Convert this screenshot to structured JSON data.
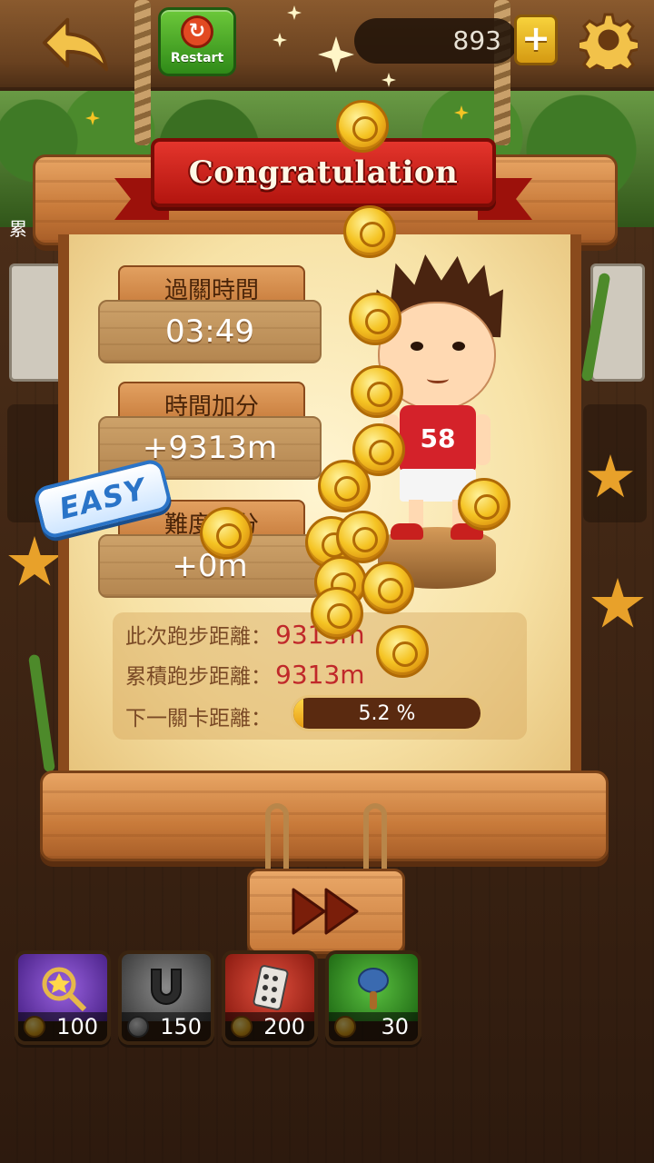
{
  "topbar": {
    "restart_label": "Restart",
    "coin_count": "893",
    "add_coin_label": "+"
  },
  "background": {
    "side_label": "累"
  },
  "result": {
    "title": "Congratulation",
    "difficulty_badge": "EASY",
    "stats": [
      {
        "label": "過關時間",
        "value": "03:49"
      },
      {
        "label": "時間加分",
        "value": "+9313m"
      },
      {
        "label": "難度加分",
        "value": "+0m"
      }
    ],
    "character_number": "58",
    "distance": {
      "this_run_label": "此次跑步距離：",
      "this_run_value": "9313m",
      "total_label": "累積跑步距離：",
      "total_value": "9313m",
      "next_level_label": "下一關卡距離：",
      "next_level_progress_text": "5.2 %",
      "next_level_progress": 5.2
    }
  },
  "powerups": [
    {
      "name": "star-wand",
      "cost": "100",
      "color": "#6a3ab0"
    },
    {
      "name": "magnet",
      "cost": "150",
      "color": "#5a5a5a"
    },
    {
      "name": "dice-card",
      "cost": "200",
      "color": "#b02a22"
    },
    {
      "name": "racket",
      "cost": "30",
      "color": "#2f8a24"
    }
  ],
  "colors": {
    "banner_red": "#d4222a",
    "progress_fill": "#f5b51e",
    "value_red": "#c0282a"
  }
}
